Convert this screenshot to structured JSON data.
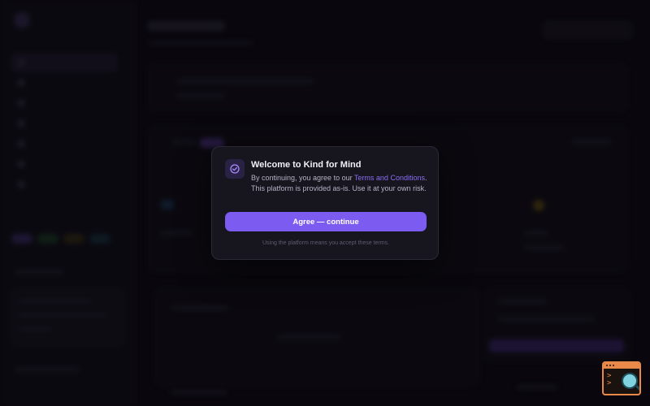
{
  "modal": {
    "title": "Welcome to Kind for Mind",
    "body_prefix": "By continuing, you agree to our ",
    "terms_link": "Terms and Conditions",
    "body_suffix": ". This platform is provided as-is. Use it at your own risk.",
    "agree_label": "Agree — continue",
    "footer": "Using the platform means you accept these terms.",
    "icon": "check-circle-icon"
  },
  "colors": {
    "accent": "#7b5bf0",
    "link": "#8b6cf5",
    "background": "#0b0a10",
    "modal_bg": "#17161e",
    "widget": "#e8894a"
  }
}
